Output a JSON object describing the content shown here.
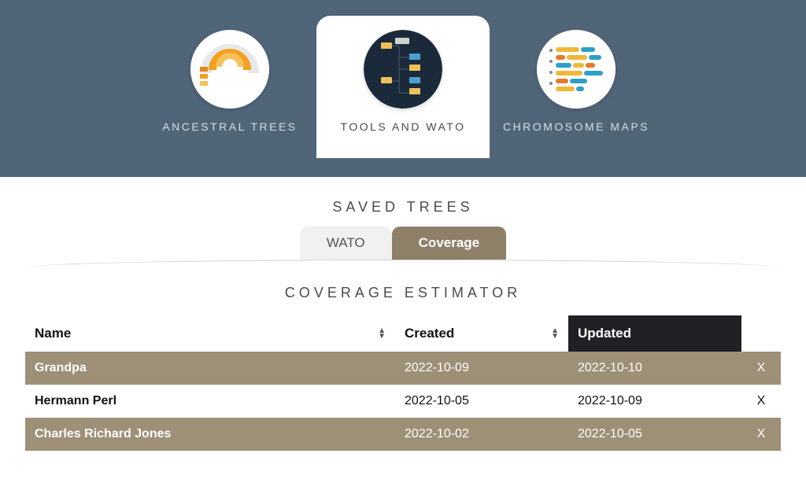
{
  "nav": {
    "items": [
      {
        "id": "ancestral",
        "label": "ANCESTRAL TREES",
        "active": false
      },
      {
        "id": "tools",
        "label": "TOOLS AND WATO",
        "active": true
      },
      {
        "id": "chromo",
        "label": "CHROMOSOME MAPS",
        "active": false
      }
    ]
  },
  "savedTrees": {
    "title": "SAVED TREES",
    "subtabs": [
      {
        "id": "wato",
        "label": "WATO",
        "active": false
      },
      {
        "id": "coverage",
        "label": "Coverage",
        "active": true
      }
    ]
  },
  "section": {
    "title": "COVERAGE ESTIMATOR"
  },
  "table": {
    "columns": {
      "name": "Name",
      "created": "Created",
      "updated": "Updated"
    },
    "sortedBy": "updated",
    "rows": [
      {
        "name": "Grandpa",
        "created": "2022-10-09",
        "updated": "2022-10-10",
        "del": "X"
      },
      {
        "name": "Hermann Perl",
        "created": "2022-10-05",
        "updated": "2022-10-09",
        "del": "X"
      },
      {
        "name": "Charles Richard Jones",
        "created": "2022-10-02",
        "updated": "2022-10-05",
        "del": "X"
      }
    ]
  },
  "colors": {
    "navBg": "#516578",
    "accent": "#8e8068",
    "rowOdd": "#9e9077",
    "sortedHeaderBg": "#1f2124"
  }
}
